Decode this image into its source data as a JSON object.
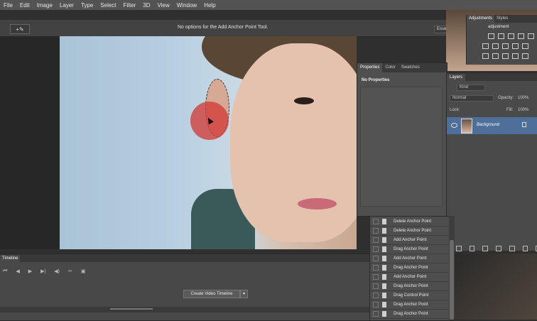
{
  "menu": [
    "File",
    "Edit",
    "Image",
    "Layer",
    "Type",
    "Select",
    "Filter",
    "3D",
    "View",
    "Window",
    "Help"
  ],
  "options_bar": {
    "tool_preset": "+✎",
    "message": "No options for the Add Anchor Point Tool.",
    "workspace": "Essentials"
  },
  "properties_panel": {
    "tabs": [
      "Properties",
      "Color",
      "Swatches"
    ],
    "title": "No Properties"
  },
  "adjustments_panel": {
    "tabs": [
      "Adjustments",
      "Styles"
    ],
    "subtitle": "adjustment"
  },
  "layers_panel": {
    "tab": "Layers",
    "kind": "Kind",
    "blend_mode": "Normal",
    "opacity_label": "Opacity:",
    "opacity_value": "100%",
    "lock_label": "Lock:",
    "fill_label": "Fill:",
    "fill_value": "100%",
    "layer_name": "Background"
  },
  "history_items": [
    "Delete Anchor Point",
    "Delete Anchor Point",
    "Add Anchor Point",
    "Drag Anchor Point",
    "Add Anchor Point",
    "Drag Anchor Point",
    "Add Anchor Point",
    "Drag Anchor Point",
    "Drag Control Point",
    "Drag Anchor Point",
    "Drag Anchor Point"
  ],
  "timeline": {
    "tab": "Timeline",
    "create_button": "Create Video Timeline",
    "controls": [
      "⏮",
      "◀",
      "▶",
      "▶|",
      "◀)",
      "✂",
      "▣"
    ]
  },
  "colors": {
    "anchor_highlight": "#d23c37",
    "selected_layer": "#4d6f9a"
  }
}
